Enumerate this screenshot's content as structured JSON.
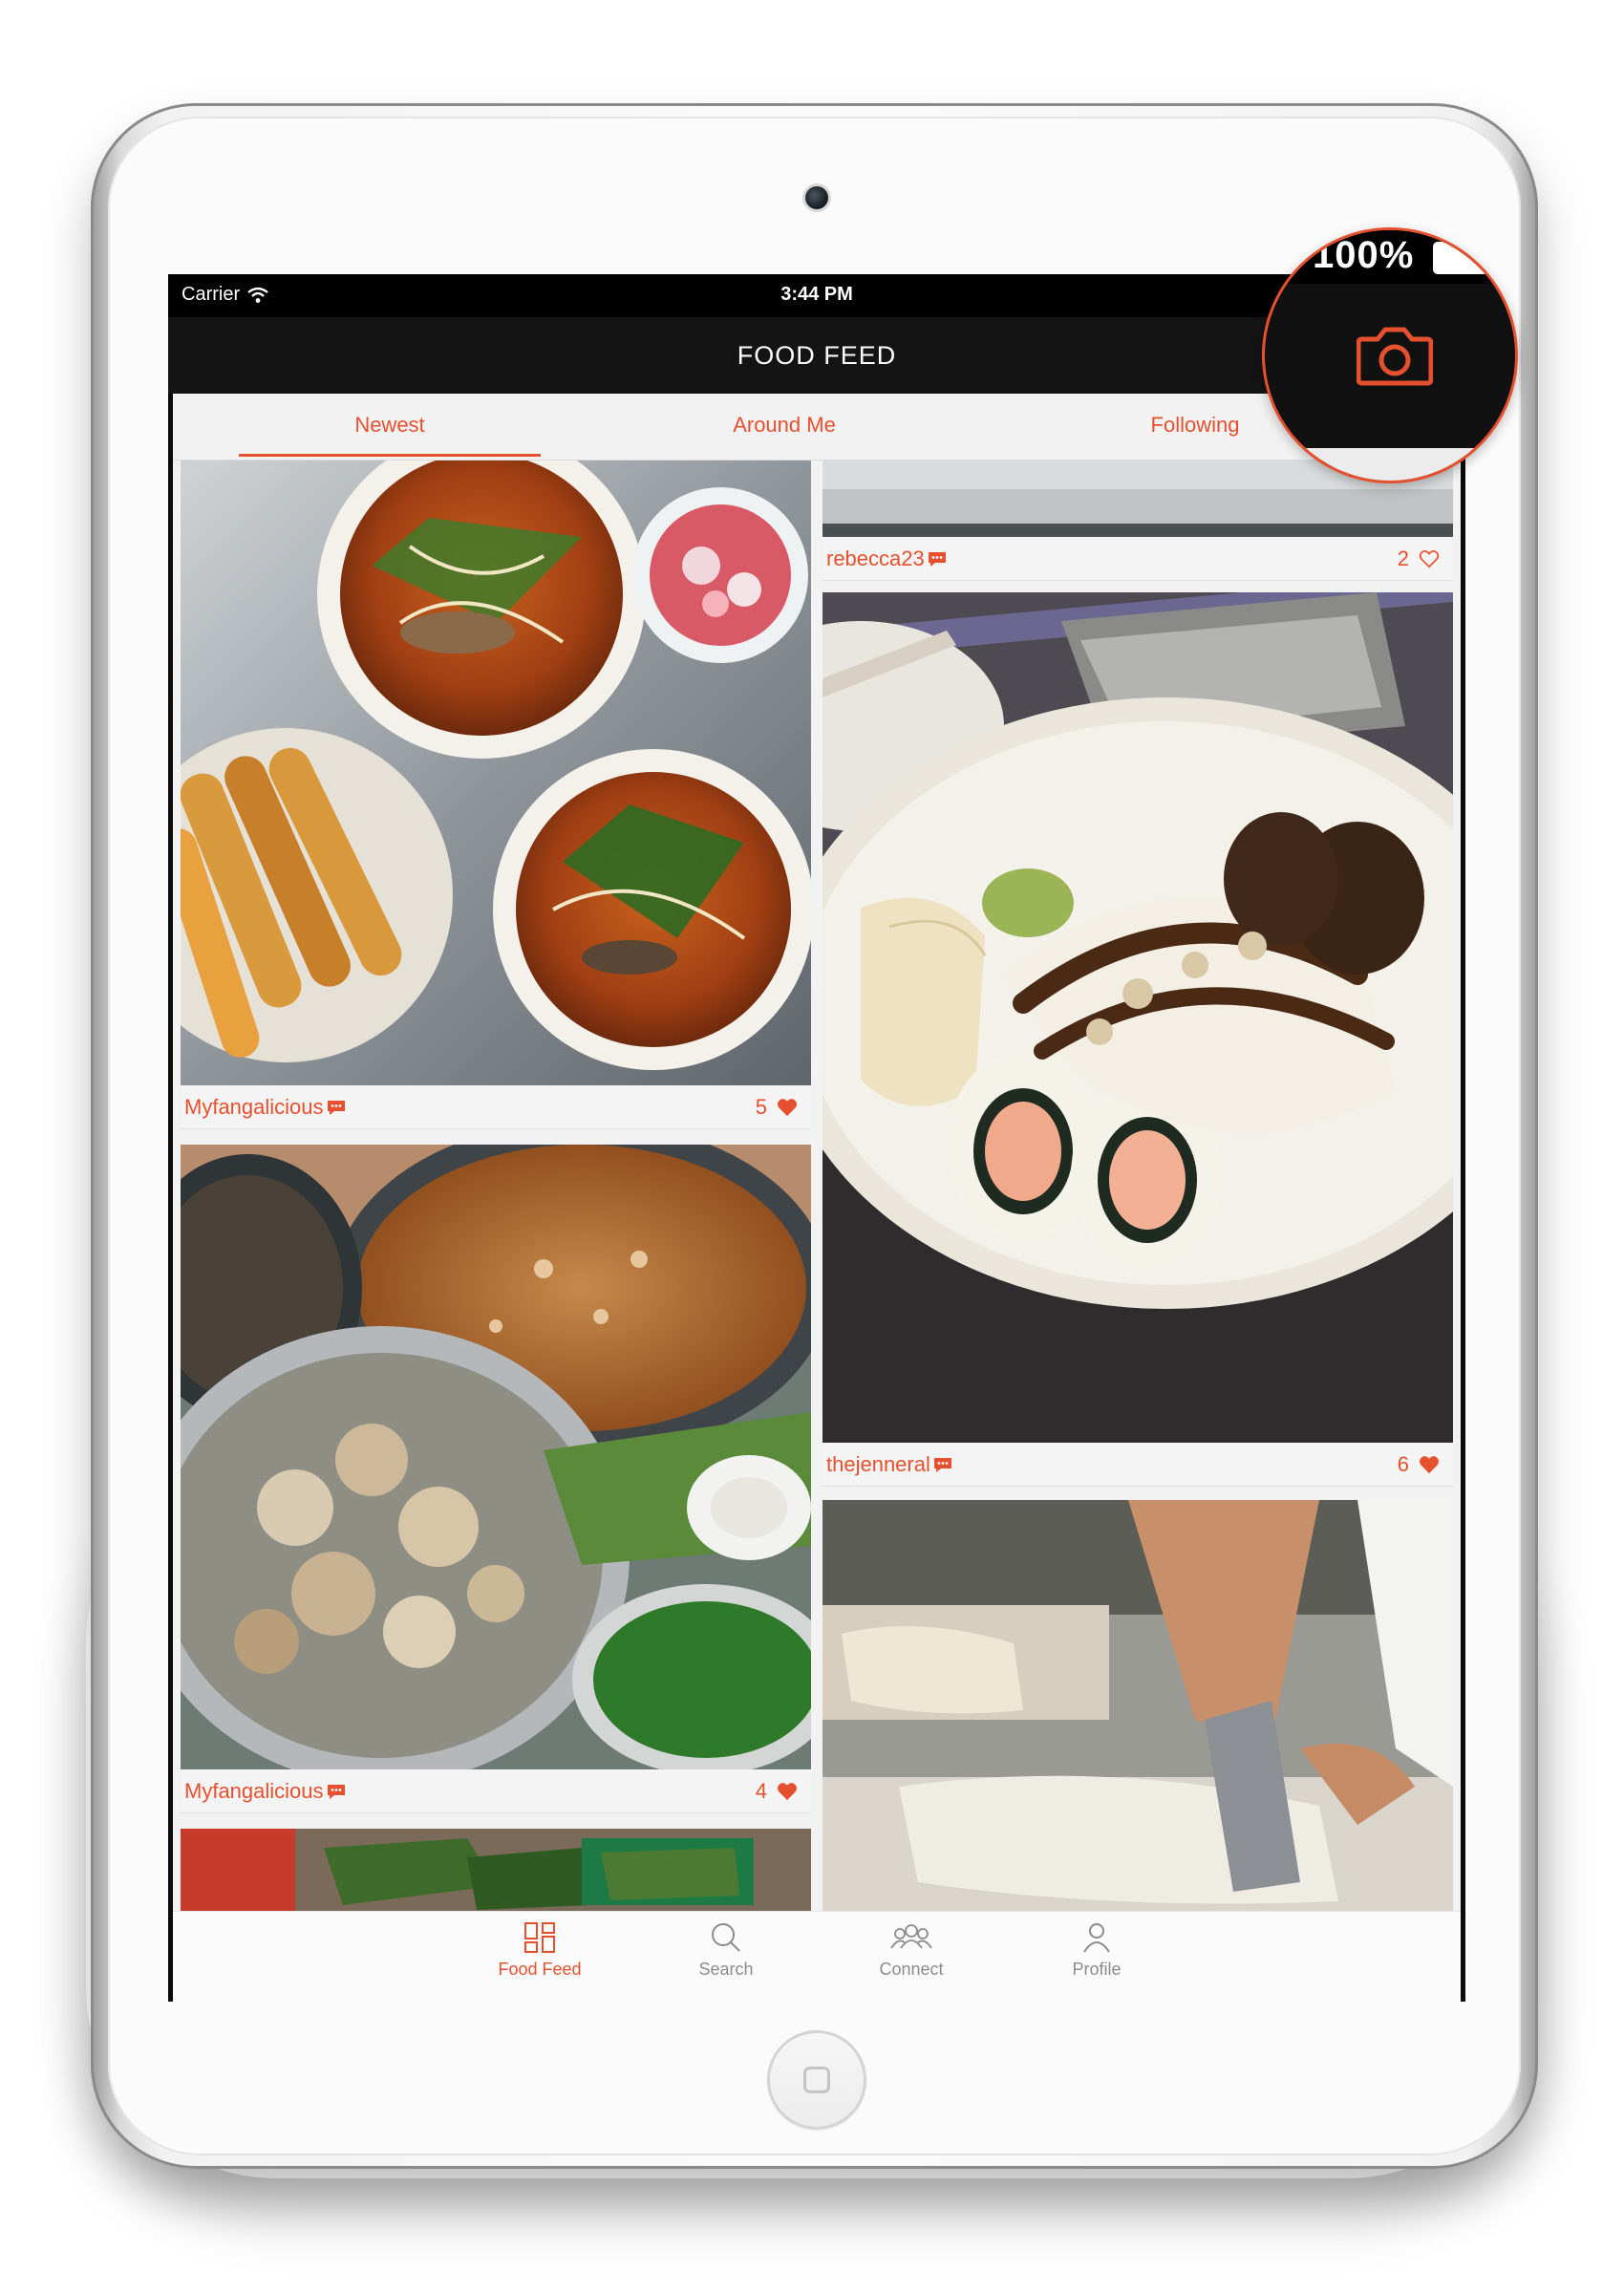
{
  "status_bar": {
    "carrier": "Carrier",
    "time": "3:44 PM",
    "battery": "100%"
  },
  "nav": {
    "title": "FOOD FEED",
    "camera_icon": "camera-icon"
  },
  "segments": [
    {
      "label": "Newest",
      "active": true
    },
    {
      "label": "Around Me",
      "active": false
    },
    {
      "label": "Following",
      "active": false
    }
  ],
  "feed": {
    "left": [
      {
        "user": "Myfangalicious",
        "likes": "5",
        "liked": true,
        "photo": "noodle soup bowls with fried dough and pickled onions"
      },
      {
        "user": "Myfangalicious",
        "likes": "4",
        "liked": true,
        "photo": "pot of braised pork trotters, broth and herbs"
      }
    ],
    "right": [
      {
        "user": "rebecca23",
        "likes": "2",
        "liked": false,
        "photo": "table top"
      },
      {
        "user": "thejenneral",
        "likes": "6",
        "liked": true,
        "photo": "sushi roll on white plate"
      }
    ]
  },
  "tab_bar": [
    {
      "label": "Food Feed",
      "icon": "grid-icon",
      "active": true
    },
    {
      "label": "Search",
      "icon": "search-icon",
      "active": false
    },
    {
      "label": "Connect",
      "icon": "people-icon",
      "active": false
    },
    {
      "label": "Profile",
      "icon": "person-icon",
      "active": false
    }
  ],
  "colors": {
    "accent": "#e5502f",
    "nav_background": "#141414",
    "feed_background": "#f2f2f2"
  }
}
